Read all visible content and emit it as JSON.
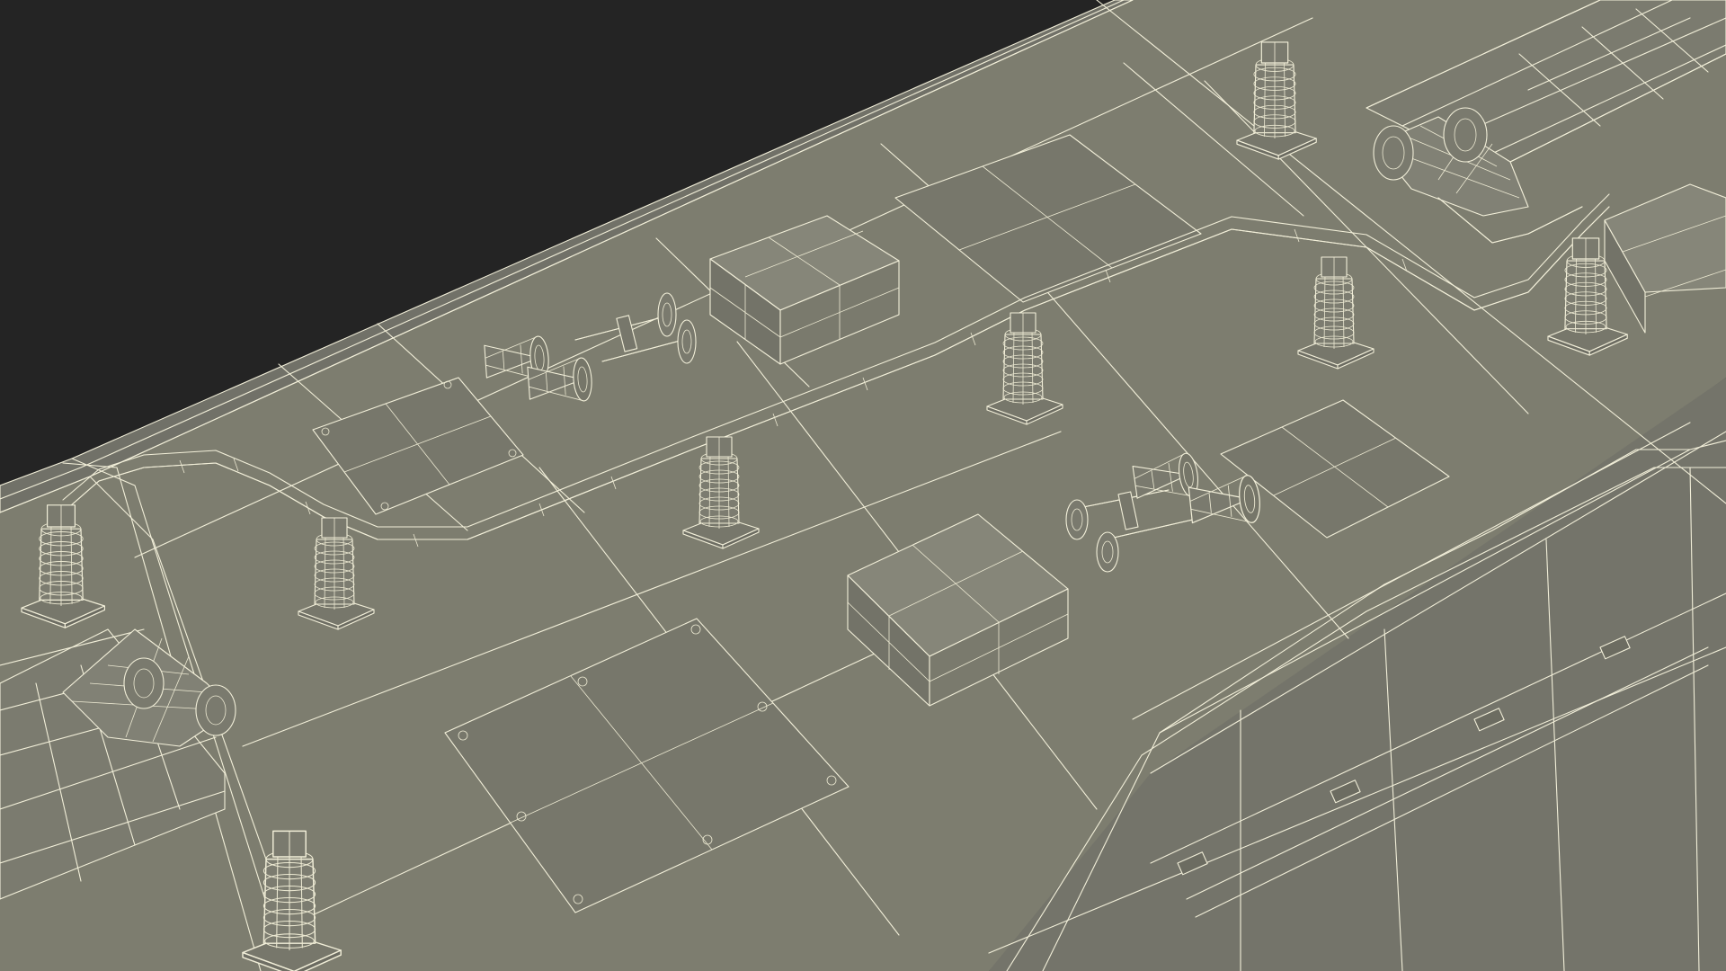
{
  "scene": {
    "subject": "locomotive-roof-wireframe",
    "colors": {
      "background": "#242424",
      "roof_fill": "#7d7d6f",
      "roof_side_fill": "#74746a",
      "roof_shadow_fill": "#6c6c61",
      "wire_color": "#f2efd9",
      "hatch_fill": "#77776b",
      "box_top_fill": "#868679",
      "box_side_fill": "#737368"
    },
    "component_counts": {
      "insulators": 8,
      "air_horns": 2,
      "equipment_boxes": 3,
      "roof_hatches": 5,
      "pantographs": 2
    }
  }
}
